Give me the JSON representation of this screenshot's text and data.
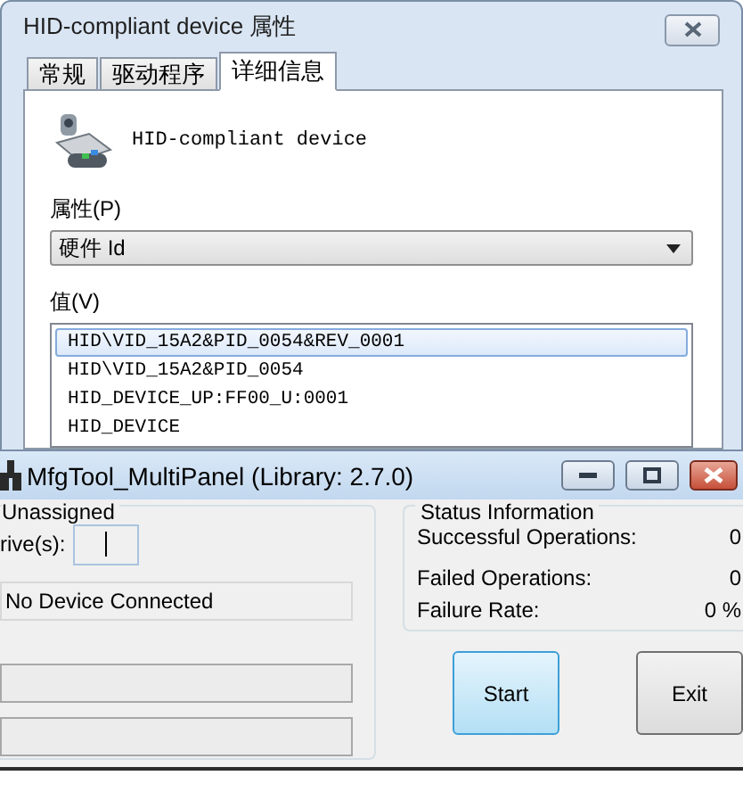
{
  "properties_window": {
    "title": "HID-compliant device 属性",
    "tabs": [
      {
        "label": "常规",
        "selected": false
      },
      {
        "label": "驱动程序",
        "selected": false
      },
      {
        "label": "详细信息",
        "selected": true
      }
    ],
    "device_name": "HID-compliant device",
    "property_label": "属性(P)",
    "property_value": "硬件 Id",
    "value_label": "值(V)",
    "values": [
      {
        "text": "HID\\VID_15A2&PID_0054&REV_0001",
        "selected": true
      },
      {
        "text": "HID\\VID_15A2&PID_0054",
        "selected": false
      },
      {
        "text": "HID_DEVICE_UP:FF00_U:0001",
        "selected": false
      },
      {
        "text": "HID_DEVICE",
        "selected": false
      }
    ]
  },
  "mfgtool_window": {
    "title": "MfgTool_MultiPanel (Library: 2.7.0)",
    "port_group": {
      "title": "Unassigned",
      "drive_label": "rive(s):",
      "device_status": "No Device Connected"
    },
    "status_group": {
      "title": "Status Information",
      "rows": [
        {
          "label": "Successful Operations:",
          "value": "0"
        },
        {
          "label": "Failed Operations:",
          "value": "0"
        },
        {
          "label": "Failure Rate:",
          "value": "0 %"
        }
      ]
    },
    "buttons": [
      {
        "label": "Start",
        "focused": true
      },
      {
        "label": "Exit",
        "focused": false
      }
    ]
  }
}
